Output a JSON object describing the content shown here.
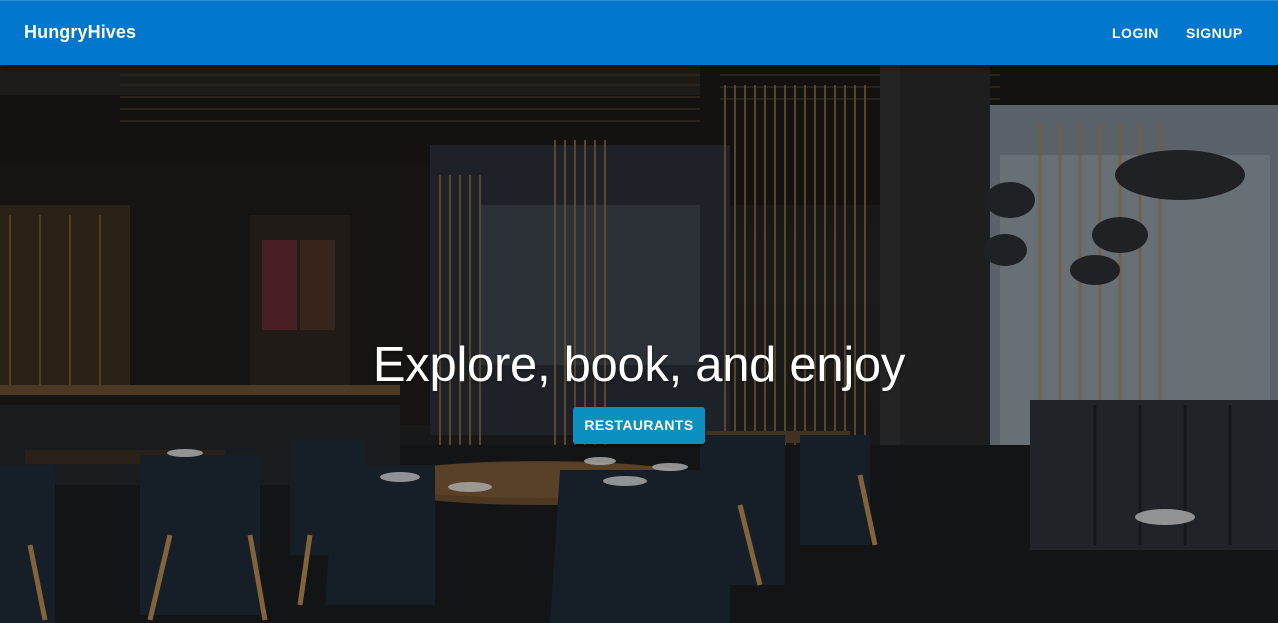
{
  "header": {
    "brand": "HungryHives",
    "login_label": "LOGIN",
    "signup_label": "SIGNUP"
  },
  "hero": {
    "title": "Explore, book, and enjoy",
    "cta_label": "RESTAURANTS",
    "background_description": ""
  },
  "colors": {
    "appbar": "#0077cc",
    "cta": "#0a8fc0"
  }
}
